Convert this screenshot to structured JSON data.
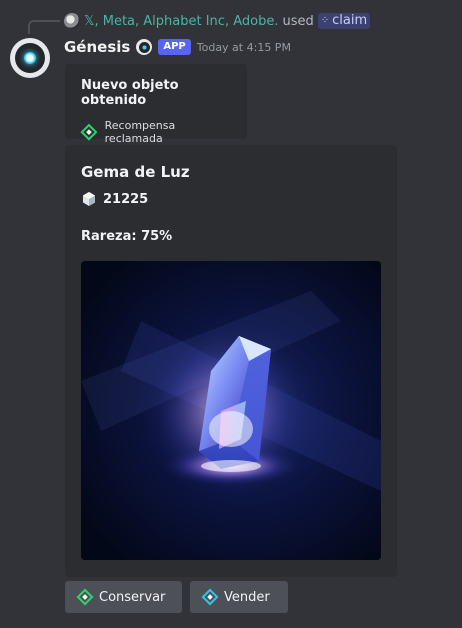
{
  "reply": {
    "users": "𝕏, Meta, Alphabet Inc, Adobe.",
    "used_text": "used",
    "command": "claim"
  },
  "message": {
    "username": "Génesis",
    "app_tag": "APP",
    "timestamp": "Today at 4:15 PM"
  },
  "notice_embed": {
    "title": "Nuevo objeto obtenido",
    "status": "Recompensa reclamada"
  },
  "item_embed": {
    "title": "Gema de Luz",
    "price": "21225",
    "rarity": "Rareza: 75%",
    "image_icon": "crystal-gem-image"
  },
  "buttons": {
    "keep_label": "Conservar",
    "sell_label": "Vender"
  },
  "colors": {
    "background": "#313338",
    "embed": "#2b2d31",
    "accent": "#5865f2",
    "reply_user": "#4bb5a6",
    "green_diamond": "#2dd36f",
    "blue_diamond": "#2ec6e8"
  }
}
